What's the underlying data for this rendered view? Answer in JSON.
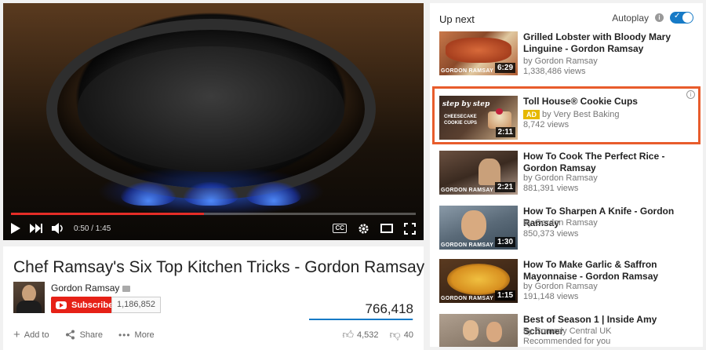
{
  "player": {
    "current_time": "0:50",
    "duration": "1:45",
    "time_display": "0:50 / 1:45",
    "progress_fraction": 0.476,
    "cc_label": "CC"
  },
  "video": {
    "title": "Chef Ramsay's Six Top Kitchen Tricks - Gordon Ramsay",
    "channel": "Gordon Ramsay",
    "subscribe_label": "Subscribe",
    "subscriber_count": "1,186,852",
    "views": "766,418",
    "like_ratio": 0.99,
    "actions": {
      "add_to": "Add to",
      "share": "Share",
      "more": "More"
    },
    "likes": "4,532",
    "dislikes": "40"
  },
  "sidebar": {
    "up_next": "Up next",
    "autoplay": "Autoplay",
    "items": [
      {
        "title": "Grilled Lobster with Bloody Mary Linguine - Gordon Ramsay",
        "channel": "by Gordon Ramsay",
        "views": "1,338,486 views",
        "duration": "6:29",
        "brand": "GORDON RAMSAY"
      },
      {
        "title": "Toll House® Cookie Cups",
        "ad_label": "AD",
        "channel": "by Very Best Baking",
        "views": "8,742 views",
        "duration": "2:11",
        "thumb_text_1": "step by step",
        "thumb_text_2": "CHEESECAKE",
        "thumb_text_3": "COOKIE CUPS"
      },
      {
        "title": "How To Cook The Perfect Rice - Gordon Ramsay",
        "channel": "by Gordon Ramsay",
        "views": "881,391 views",
        "duration": "2:21",
        "brand": "GORDON RAMSAY"
      },
      {
        "title": "How To Sharpen A Knife - Gordon Ramsay",
        "channel": "by Gordon Ramsay",
        "views": "850,373 views",
        "duration": "1:30",
        "brand": "GORDON RAMSAY"
      },
      {
        "title": "How To Make Garlic & Saffron Mayonnaise - Gordon Ramsay",
        "channel": "by Gordon Ramsay",
        "views": "191,148 views",
        "duration": "1:15",
        "brand": "GORDON RAMSAY"
      },
      {
        "title": "Best of Season 1 | Inside Amy Schumer",
        "channel": "by Comedy Central UK",
        "views": "Recommended for you"
      }
    ]
  },
  "colors": {
    "accent_red": "#e52d27",
    "subscribe_red": "#e62117",
    "ad_highlight": "#e85c2c",
    "toggle_blue": "#167ac6",
    "ad_badge": "#e6b800"
  }
}
